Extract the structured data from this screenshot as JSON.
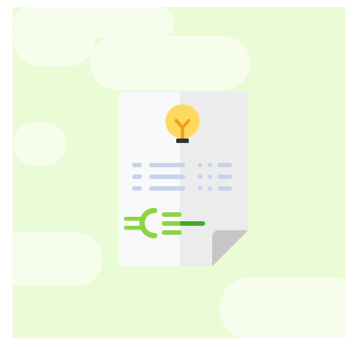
{
  "illustration": {
    "subject": "electricity-bill-document",
    "icons": [
      "lightbulb-icon",
      "euro-icon"
    ],
    "colors": {
      "background_light": "#eafcd6",
      "background_cloud": "#f6fdec",
      "paper": "#f9f9f9",
      "paper_shade": "#ececec",
      "paper_fold": "#c6c6c6",
      "bulb_glass": "#fed95e",
      "bulb_filament": "#f29a1f",
      "bulb_base": "#333333",
      "text_lines": "#c7d3ea",
      "euro_green": "#8bd443",
      "line_green": "#44a829"
    }
  }
}
